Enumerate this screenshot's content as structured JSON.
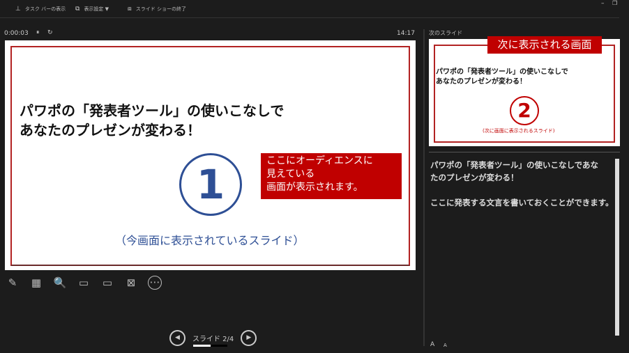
{
  "toolbar": {
    "taskbar": "タスク バーの表示",
    "display": "表示設定 ▼",
    "end": "スライド ショーの終了"
  },
  "window": {
    "minimize": "–",
    "restore": "❐"
  },
  "timer": {
    "elapsed": "0:00:03",
    "pause": "⏸",
    "reset": "↻",
    "clock": "14:17"
  },
  "current_slide": {
    "title_line1": "パワポの「発表者ツール」の使いこなしで",
    "title_line2": "あなたのプレゼンが変わる！",
    "number": "1",
    "caption": "（今画面に表示されているスライド）",
    "note_line1": "ここにオーディエンスに",
    "note_line2": "見えている",
    "note_line3": "画面が表示されます。"
  },
  "tools": {
    "pen": "✎",
    "grid": "▦",
    "zoom": "🔍",
    "black": "▭",
    "subtitle": "▭",
    "camera": "⊠",
    "more": "⋯"
  },
  "nav": {
    "prev": "◀",
    "label": "スライド 2/4",
    "next": "▶",
    "progress": 0.5
  },
  "next_slide": {
    "header": "次のスライド",
    "tag": "次に表示される画面",
    "title_line1": "パワポの「発表者ツール」の使いこなしで",
    "title_line2": "あなたのプレゼンが変わる！",
    "number": "2",
    "caption": "(次に画面に表示されるスライド)"
  },
  "notes": {
    "line1": "パワポの「発表者ツール」の使いこなしであな",
    "line2": "たのプレゼンが変わる！",
    "line3": "ここに発表する文言を書いておくことができます。",
    "font_up": "A",
    "font_down": "A"
  }
}
